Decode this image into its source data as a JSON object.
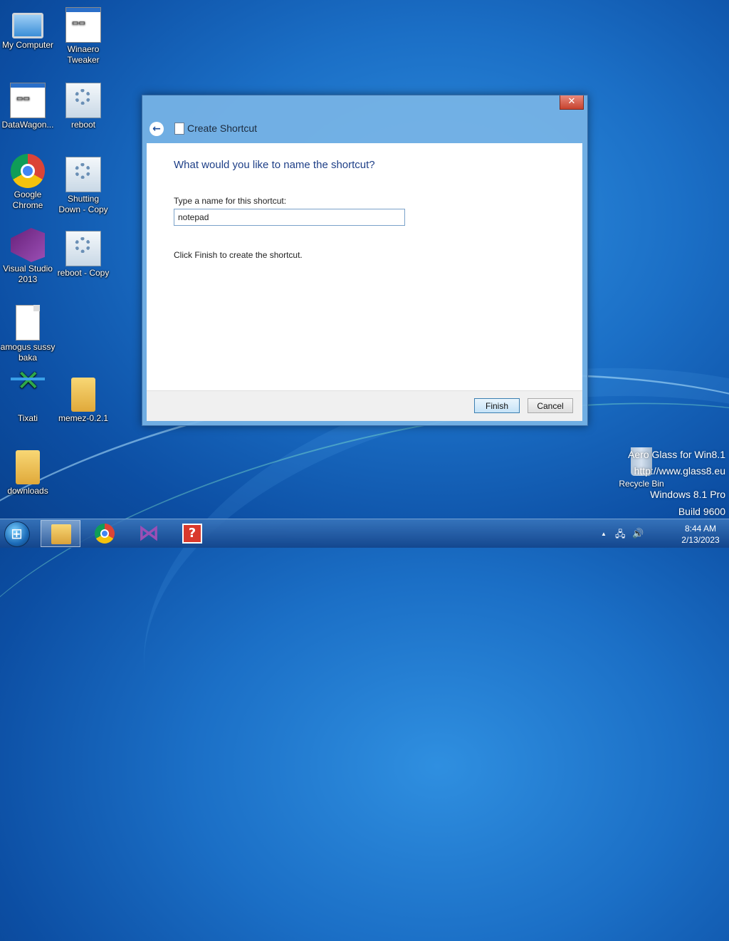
{
  "desktop": {
    "icons": [
      {
        "label": "My Computer",
        "icon": "computer-icon"
      },
      {
        "label": "Winaero Tweaker",
        "icon": "app-icon"
      },
      {
        "label": "DataWagon...",
        "icon": "app-icon"
      },
      {
        "label": "reboot",
        "icon": "gear-script-icon"
      },
      {
        "label": "Google Chrome",
        "icon": "chrome-icon"
      },
      {
        "label": "Shutting Down - Copy",
        "icon": "gear-script-icon"
      },
      {
        "label": "Visual Studio 2013",
        "icon": "visual-studio-icon"
      },
      {
        "label": "reboot - Copy",
        "icon": "gear-script-icon"
      },
      {
        "label": "amogus sussy baka",
        "icon": "text-document-icon"
      },
      {
        "label": "Tixati",
        "icon": "tixati-icon"
      },
      {
        "label": "memez-0.2.1",
        "icon": "folder-icon"
      },
      {
        "label": "downloads",
        "icon": "folder-icon"
      },
      {
        "label": "Recycle Bin",
        "icon": "recycle-bin-icon"
      }
    ],
    "watermark": {
      "line1": "Aero Glass for Win8.1",
      "line2": "http://www.glass8.eu",
      "line3": "Windows 8.1 Pro",
      "line4": "Build 9600"
    }
  },
  "dialog": {
    "title": "Create Shortcut",
    "close_symbol": "✕",
    "back_symbol": "←",
    "question": "What would you like to name the shortcut?",
    "name_label": "Type a name for this shortcut:",
    "name_value": "notepad",
    "info": "Click Finish to create the shortcut.",
    "finish_label": "Finish",
    "cancel_label": "Cancel"
  },
  "taskbar": {
    "pinned": [
      {
        "name": "File Explorer",
        "icon": "file-explorer-icon",
        "active": true
      },
      {
        "name": "Google Chrome",
        "icon": "chrome-icon",
        "active": false
      },
      {
        "name": "Visual Studio",
        "icon": "visual-studio-icon",
        "active": false
      },
      {
        "name": "Help",
        "icon": "help-icon",
        "active": false
      }
    ],
    "tray": {
      "time": "8:44 AM",
      "date": "2/13/2023",
      "up_arrow": "▲",
      "network": "🖧",
      "volume": "🔊"
    }
  }
}
